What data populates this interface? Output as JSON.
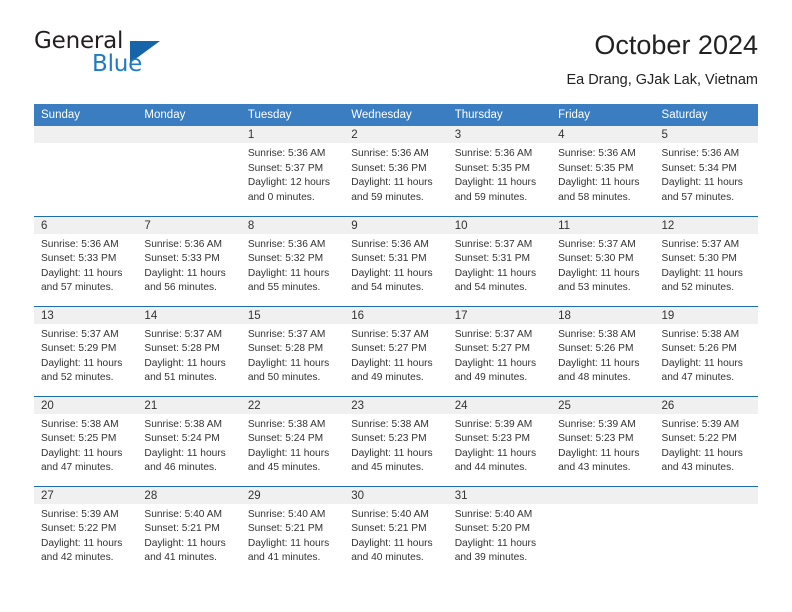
{
  "brand": {
    "name_top": "General",
    "name_bottom": "Blue",
    "accent_color": "#1565a8",
    "text_color": "#231f20",
    "blue_text_color": "#1f7bc1",
    "triangle_icon": "brand-triangle-icon"
  },
  "header": {
    "title": "October 2024",
    "subtitle": "Ea Drang, GJak Lak, Vietnam"
  },
  "theme": {
    "header_band": "#3a7dc0",
    "week_divider": "#1f6cb0",
    "daynum_band": "#f0f0f0",
    "body_text": "#333333"
  },
  "calendar": {
    "weekday_headers": [
      "Sunday",
      "Monday",
      "Tuesday",
      "Wednesday",
      "Thursday",
      "Friday",
      "Saturday"
    ],
    "weeks": [
      [
        {
          "day": "",
          "lines": []
        },
        {
          "day": "",
          "lines": []
        },
        {
          "day": "1",
          "lines": [
            "Sunrise: 5:36 AM",
            "Sunset: 5:37 PM",
            "Daylight: 12 hours",
            "and 0 minutes."
          ]
        },
        {
          "day": "2",
          "lines": [
            "Sunrise: 5:36 AM",
            "Sunset: 5:36 PM",
            "Daylight: 11 hours",
            "and 59 minutes."
          ]
        },
        {
          "day": "3",
          "lines": [
            "Sunrise: 5:36 AM",
            "Sunset: 5:35 PM",
            "Daylight: 11 hours",
            "and 59 minutes."
          ]
        },
        {
          "day": "4",
          "lines": [
            "Sunrise: 5:36 AM",
            "Sunset: 5:35 PM",
            "Daylight: 11 hours",
            "and 58 minutes."
          ]
        },
        {
          "day": "5",
          "lines": [
            "Sunrise: 5:36 AM",
            "Sunset: 5:34 PM",
            "Daylight: 11 hours",
            "and 57 minutes."
          ]
        }
      ],
      [
        {
          "day": "6",
          "lines": [
            "Sunrise: 5:36 AM",
            "Sunset: 5:33 PM",
            "Daylight: 11 hours",
            "and 57 minutes."
          ]
        },
        {
          "day": "7",
          "lines": [
            "Sunrise: 5:36 AM",
            "Sunset: 5:33 PM",
            "Daylight: 11 hours",
            "and 56 minutes."
          ]
        },
        {
          "day": "8",
          "lines": [
            "Sunrise: 5:36 AM",
            "Sunset: 5:32 PM",
            "Daylight: 11 hours",
            "and 55 minutes."
          ]
        },
        {
          "day": "9",
          "lines": [
            "Sunrise: 5:36 AM",
            "Sunset: 5:31 PM",
            "Daylight: 11 hours",
            "and 54 minutes."
          ]
        },
        {
          "day": "10",
          "lines": [
            "Sunrise: 5:37 AM",
            "Sunset: 5:31 PM",
            "Daylight: 11 hours",
            "and 54 minutes."
          ]
        },
        {
          "day": "11",
          "lines": [
            "Sunrise: 5:37 AM",
            "Sunset: 5:30 PM",
            "Daylight: 11 hours",
            "and 53 minutes."
          ]
        },
        {
          "day": "12",
          "lines": [
            "Sunrise: 5:37 AM",
            "Sunset: 5:30 PM",
            "Daylight: 11 hours",
            "and 52 minutes."
          ]
        }
      ],
      [
        {
          "day": "13",
          "lines": [
            "Sunrise: 5:37 AM",
            "Sunset: 5:29 PM",
            "Daylight: 11 hours",
            "and 52 minutes."
          ]
        },
        {
          "day": "14",
          "lines": [
            "Sunrise: 5:37 AM",
            "Sunset: 5:28 PM",
            "Daylight: 11 hours",
            "and 51 minutes."
          ]
        },
        {
          "day": "15",
          "lines": [
            "Sunrise: 5:37 AM",
            "Sunset: 5:28 PM",
            "Daylight: 11 hours",
            "and 50 minutes."
          ]
        },
        {
          "day": "16",
          "lines": [
            "Sunrise: 5:37 AM",
            "Sunset: 5:27 PM",
            "Daylight: 11 hours",
            "and 49 minutes."
          ]
        },
        {
          "day": "17",
          "lines": [
            "Sunrise: 5:37 AM",
            "Sunset: 5:27 PM",
            "Daylight: 11 hours",
            "and 49 minutes."
          ]
        },
        {
          "day": "18",
          "lines": [
            "Sunrise: 5:38 AM",
            "Sunset: 5:26 PM",
            "Daylight: 11 hours",
            "and 48 minutes."
          ]
        },
        {
          "day": "19",
          "lines": [
            "Sunrise: 5:38 AM",
            "Sunset: 5:26 PM",
            "Daylight: 11 hours",
            "and 47 minutes."
          ]
        }
      ],
      [
        {
          "day": "20",
          "lines": [
            "Sunrise: 5:38 AM",
            "Sunset: 5:25 PM",
            "Daylight: 11 hours",
            "and 47 minutes."
          ]
        },
        {
          "day": "21",
          "lines": [
            "Sunrise: 5:38 AM",
            "Sunset: 5:24 PM",
            "Daylight: 11 hours",
            "and 46 minutes."
          ]
        },
        {
          "day": "22",
          "lines": [
            "Sunrise: 5:38 AM",
            "Sunset: 5:24 PM",
            "Daylight: 11 hours",
            "and 45 minutes."
          ]
        },
        {
          "day": "23",
          "lines": [
            "Sunrise: 5:38 AM",
            "Sunset: 5:23 PM",
            "Daylight: 11 hours",
            "and 45 minutes."
          ]
        },
        {
          "day": "24",
          "lines": [
            "Sunrise: 5:39 AM",
            "Sunset: 5:23 PM",
            "Daylight: 11 hours",
            "and 44 minutes."
          ]
        },
        {
          "day": "25",
          "lines": [
            "Sunrise: 5:39 AM",
            "Sunset: 5:23 PM",
            "Daylight: 11 hours",
            "and 43 minutes."
          ]
        },
        {
          "day": "26",
          "lines": [
            "Sunrise: 5:39 AM",
            "Sunset: 5:22 PM",
            "Daylight: 11 hours",
            "and 43 minutes."
          ]
        }
      ],
      [
        {
          "day": "27",
          "lines": [
            "Sunrise: 5:39 AM",
            "Sunset: 5:22 PM",
            "Daylight: 11 hours",
            "and 42 minutes."
          ]
        },
        {
          "day": "28",
          "lines": [
            "Sunrise: 5:40 AM",
            "Sunset: 5:21 PM",
            "Daylight: 11 hours",
            "and 41 minutes."
          ]
        },
        {
          "day": "29",
          "lines": [
            "Sunrise: 5:40 AM",
            "Sunset: 5:21 PM",
            "Daylight: 11 hours",
            "and 41 minutes."
          ]
        },
        {
          "day": "30",
          "lines": [
            "Sunrise: 5:40 AM",
            "Sunset: 5:21 PM",
            "Daylight: 11 hours",
            "and 40 minutes."
          ]
        },
        {
          "day": "31",
          "lines": [
            "Sunrise: 5:40 AM",
            "Sunset: 5:20 PM",
            "Daylight: 11 hours",
            "and 39 minutes."
          ]
        },
        {
          "day": "",
          "lines": []
        },
        {
          "day": "",
          "lines": []
        }
      ]
    ]
  }
}
